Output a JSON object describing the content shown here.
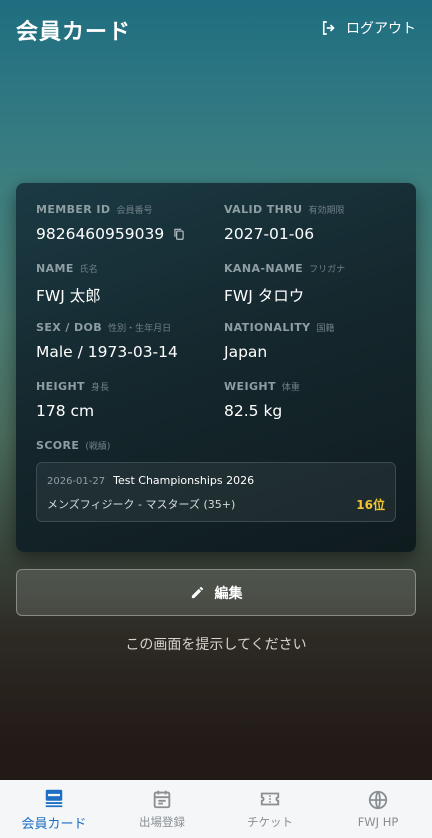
{
  "header": {
    "title": "会員カード",
    "logout_label": "ログアウト"
  },
  "card": {
    "member_id": {
      "label": "MEMBER ID",
      "sub": "会員番号",
      "value": "9826460959039"
    },
    "valid_thru": {
      "label": "VALID THRU",
      "sub": "有効期限",
      "value": "2027-01-06"
    },
    "name": {
      "label": "NAME",
      "sub": "氏名",
      "value": "FWJ 太郎"
    },
    "kana_name": {
      "label": "KANA-NAME",
      "sub": "フリガナ",
      "value": "FWJ タロウ"
    },
    "sex_dob": {
      "label": "SEX / DOB",
      "sub": "性別・生年月日",
      "value": "Male / 1973-03-14"
    },
    "nationality": {
      "label": "NATIONALITY",
      "sub": "国籍",
      "value": "Japan"
    },
    "height": {
      "label": "HEIGHT",
      "sub": "身長",
      "value": "178 cm"
    },
    "weight": {
      "label": "WEIGHT",
      "sub": "体重",
      "value": "82.5 kg"
    },
    "score": {
      "label": "SCORE",
      "sub": "(戦績)",
      "entries": [
        {
          "date": "2026-01-27",
          "event": "Test Championships 2026",
          "category": "メンズフィジーク - マスターズ (35+)",
          "rank": "16位"
        }
      ]
    }
  },
  "edit_label": "編集",
  "notice": "この画面を提示してください",
  "nav": {
    "items": [
      {
        "label": "会員カード",
        "icon": "card-icon",
        "active": true
      },
      {
        "label": "出場登録",
        "icon": "calendar-icon",
        "active": false
      },
      {
        "label": "チケット",
        "icon": "ticket-icon",
        "active": false
      },
      {
        "label": "FWJ HP",
        "icon": "globe-icon",
        "active": false
      }
    ]
  },
  "colors": {
    "accent": "#1c6fc4",
    "rank": "#f3c534"
  }
}
